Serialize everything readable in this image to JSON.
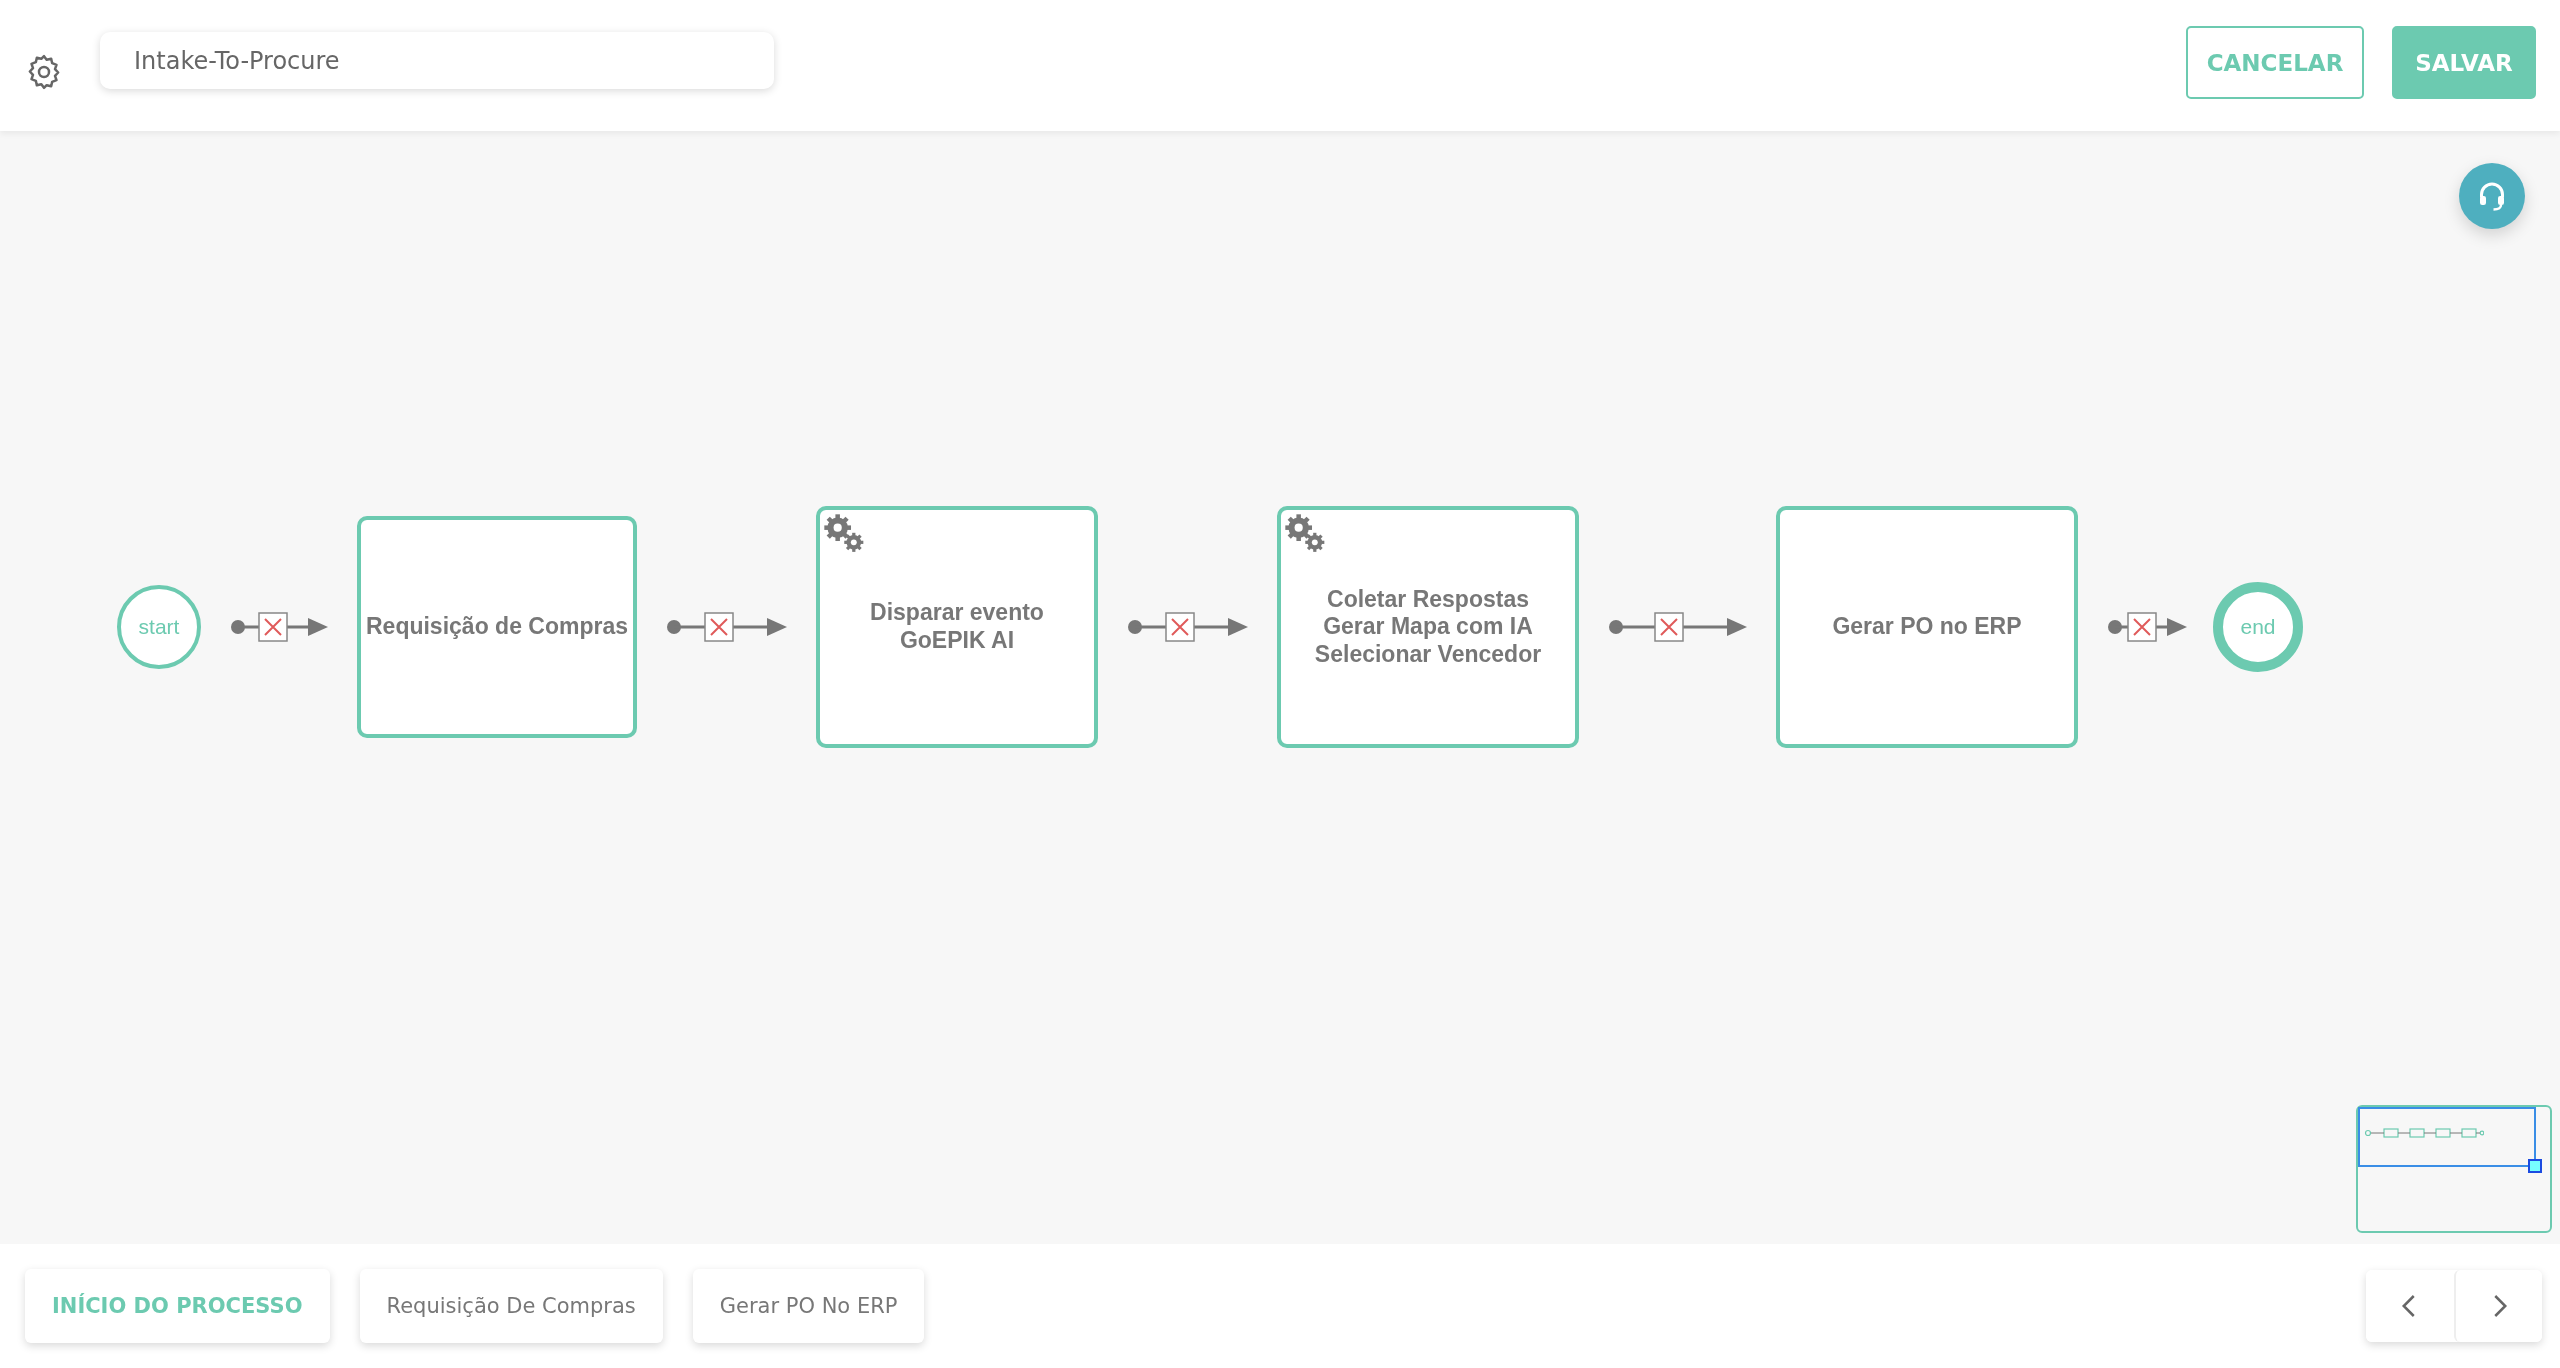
{
  "process_name": {
    "value": "Intake-To-Procure"
  },
  "actions": [
    {
      "label": "CANCELAR",
      "kind": "outline"
    },
    {
      "label": "SALVAR",
      "kind": "filled"
    }
  ],
  "diagram": {
    "nodes": [
      {
        "kind": "start",
        "label": "start"
      },
      {
        "kind": "task",
        "label": "Requisição de Compras"
      },
      {
        "kind": "service_task",
        "label": "Disparar evento\nGoEPIK AI"
      },
      {
        "kind": "service_task",
        "label": "Coletar Respostas\nGerar Mapa com IA\nSelecionar Vencedor"
      },
      {
        "kind": "task",
        "label": "Gerar PO no ERP"
      },
      {
        "kind": "end",
        "label": "end"
      }
    ]
  },
  "steps": [
    {
      "label": "INÍCIO DO PROCESSO",
      "selected": true
    },
    {
      "label": "Requisição De Compras",
      "selected": false
    },
    {
      "label": "Gerar PO No ERP",
      "selected": false
    }
  ]
}
